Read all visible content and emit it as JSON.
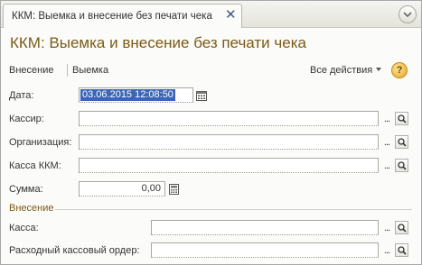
{
  "tab": {
    "title": "ККМ: Выемка и внесение без печати чека"
  },
  "page_title": "ККМ: Выемка и внесение без печати чека",
  "commands": {
    "deposit": "Внесение",
    "withdrawal": "Выемка",
    "all_actions": "Все действия",
    "help": "?"
  },
  "form": {
    "date": {
      "label": "Дата:",
      "value": "03.06.2015 12:08:50"
    },
    "cashier": {
      "label": "Кассир:",
      "value": ""
    },
    "organization": {
      "label": "Организация:",
      "value": ""
    },
    "kkm_register": {
      "label": "Касса ККМ:",
      "value": ""
    },
    "amount": {
      "label": "Сумма:",
      "value": "0,00"
    }
  },
  "deposit_section": {
    "title": "Внесение",
    "cash_desk": {
      "label": "Касса:",
      "value": ""
    },
    "expense_order": {
      "label": "Расходный кассовый ордер:",
      "value": ""
    }
  },
  "colors": {
    "title": "#7a5b16",
    "selection": "#3b66b6",
    "close": "#3d5a80"
  }
}
